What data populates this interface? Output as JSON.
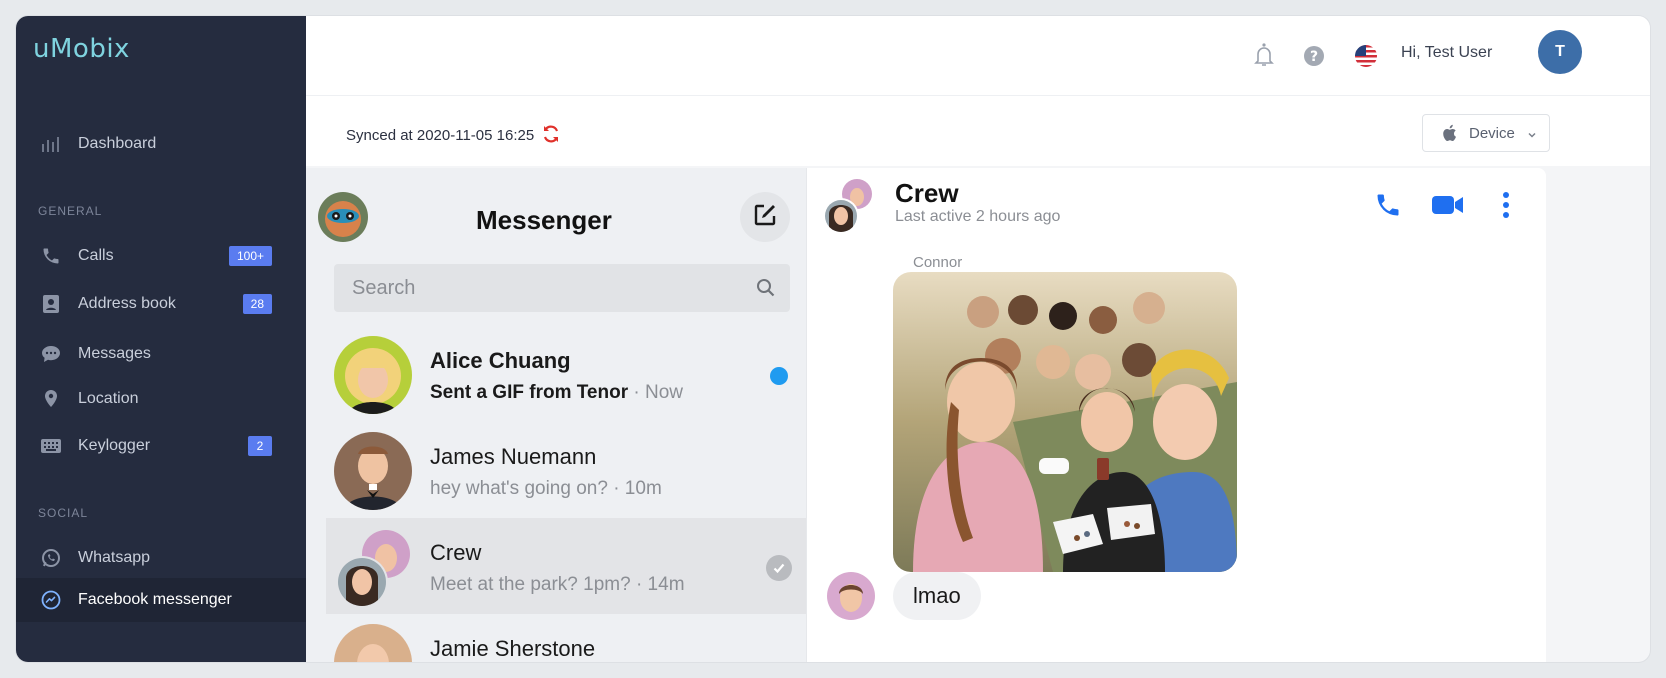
{
  "brand": "uMobix",
  "sidebar": {
    "dashboard": "Dashboard",
    "general_label": "GENERAL",
    "social_label": "SOCIAL",
    "items": [
      {
        "label": "Calls",
        "badge": "100+"
      },
      {
        "label": "Address book",
        "badge": "28"
      },
      {
        "label": "Messages"
      },
      {
        "label": "Location"
      },
      {
        "label": "Keylogger",
        "badge": "2"
      },
      {
        "label": "Whatsapp"
      },
      {
        "label": "Facebook messenger"
      }
    ]
  },
  "topbar": {
    "greeting": "Hi, Test User",
    "avatar_initial": "T"
  },
  "sync": {
    "text": "Synced at 2020-11-05 16:25",
    "device_label": "Device"
  },
  "messenger": {
    "title": "Messenger",
    "search_placeholder": "Search",
    "conversations": [
      {
        "name": "Alice Chuang",
        "sender_text": "Sent a GIF from Tenor",
        "time": " · Now"
      },
      {
        "name": "James Nuemann",
        "preview": "hey what's going on? · 10m"
      },
      {
        "name": "Crew",
        "preview": "Meet at the park? 1pm? · 14m"
      },
      {
        "name": "Jamie Sherstone"
      }
    ]
  },
  "chat": {
    "name": "Crew",
    "status": "Last active 2 hours ago",
    "sender": "Connor",
    "message": "lmao"
  },
  "colors": {
    "sidebar_bg": "#252c3f",
    "accent_blue": "#1f6ff0",
    "badge_blue": "#5a7cf0",
    "unread_dot": "#1f9bf0",
    "sync_red": "#e0312b"
  }
}
